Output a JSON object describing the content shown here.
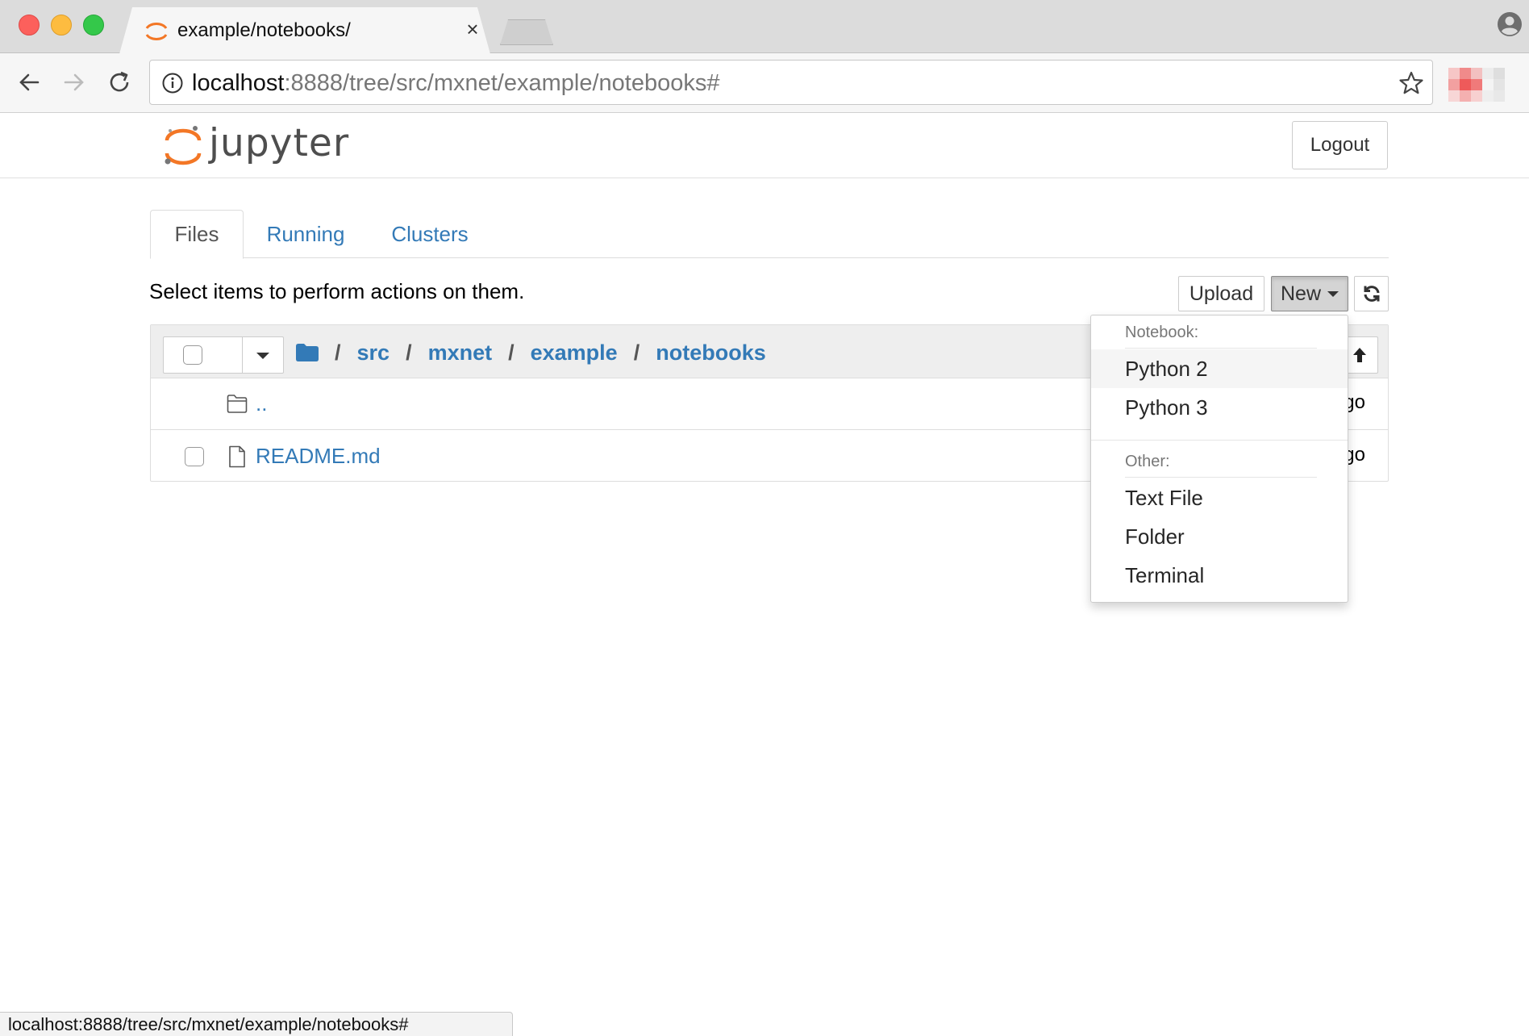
{
  "browser": {
    "tab_title": "example/notebooks/",
    "tab_close": "×",
    "url_host": "localhost",
    "url_path": ":8888/tree/src/mxnet/example/notebooks#",
    "status_url": "localhost:8888/tree/src/mxnet/example/notebooks#"
  },
  "header": {
    "logo_text": "jupyter",
    "logout_label": "Logout"
  },
  "tabs": [
    {
      "label": "Files",
      "active": true
    },
    {
      "label": "Running",
      "active": false
    },
    {
      "label": "Clusters",
      "active": false
    }
  ],
  "toolbar": {
    "hint": "Select items to perform actions on them.",
    "upload_label": "Upload",
    "new_label": "New"
  },
  "breadcrumb": {
    "separator": "/",
    "items": [
      "src",
      "mxnet",
      "example",
      "notebooks"
    ]
  },
  "files": [
    {
      "name": "..",
      "type": "folder",
      "modified": "go"
    },
    {
      "name": "README.md",
      "type": "file",
      "modified": "go"
    }
  ],
  "new_menu": {
    "notebook_header": "Notebook:",
    "notebook_items": [
      "Python 2",
      "Python 3"
    ],
    "other_header": "Other:",
    "other_items": [
      "Text File",
      "Folder",
      "Terminal"
    ]
  },
  "colors": {
    "link": "#337ab7",
    "jupyter_orange": "#f37726"
  }
}
